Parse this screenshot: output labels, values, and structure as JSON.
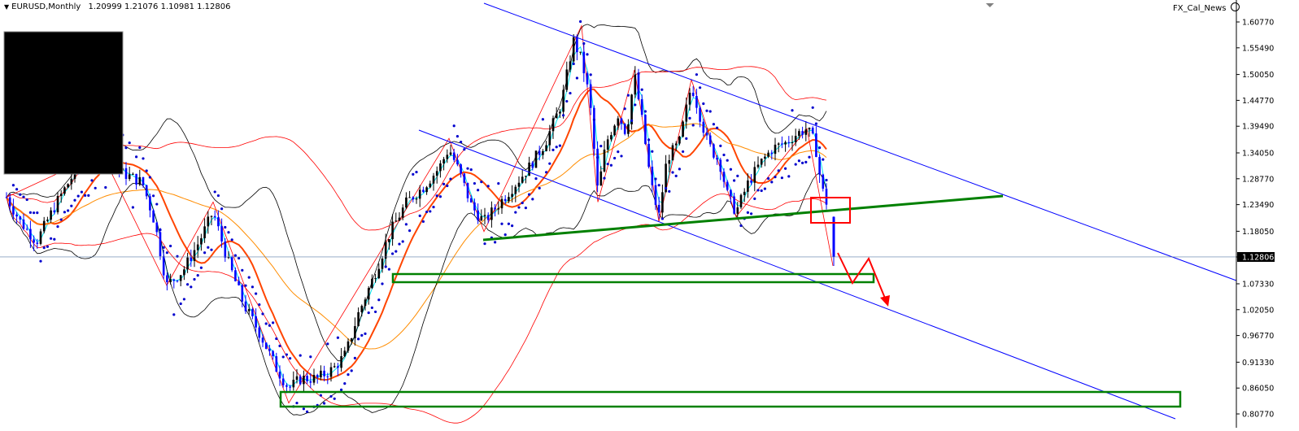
{
  "header": {
    "symbol": "EURUSD,Monthly",
    "ohlc": "1.20999 1.21076 1.10981 1.12806",
    "indicator": "FX_Cal_News"
  },
  "colors": {
    "background": "#ffffff",
    "bull_candle": "#000000",
    "bear_candle": "#0000ff",
    "channel": "#0000ff",
    "support_zone": "#008000",
    "highlight_box": "#ff0000",
    "bollinger": "#000000",
    "envelope": "#ff0000",
    "ma_slow": "#ff4500",
    "ma_fast": "#00e5ee",
    "ma_long": "#ff8c00",
    "sar": "#0000cd",
    "price_tag_bg": "#000000",
    "price_tag_text": "#ffffff"
  },
  "chart_data": {
    "type": "candlestick",
    "symbol": "EURUSD",
    "timeframe": "Monthly",
    "ylim": [
      0.8077,
      1.645
    ],
    "y_ticks": [
      "1.60770",
      "1.55490",
      "1.50050",
      "1.44770",
      "1.39490",
      "1.34050",
      "1.28770",
      "1.23490",
      "1.18050",
      "1.12806",
      "1.07330",
      "1.02050",
      "0.96770",
      "0.91330",
      "0.86050",
      "0.80770"
    ],
    "current_price": "1.12806",
    "last_bar": {
      "open": 1.20999,
      "high": 1.21076,
      "low": 1.10981,
      "close": 1.12806
    },
    "overlays": [
      "Bollinger Bands",
      "Moving averages",
      "Parabolic SAR",
      "Envelopes"
    ],
    "annotations": [
      "descending channel (two parallel blue lines)",
      "green rising trendline",
      "red box at the trendline break",
      "green support zone near 1.08",
      "green support zone near 0.84",
      "red projected path with downward arrow"
    ]
  }
}
